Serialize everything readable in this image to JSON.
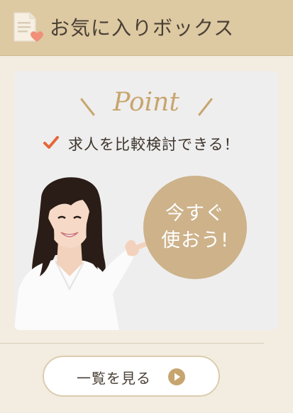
{
  "header": {
    "title": "お気に入りボックス",
    "icon": "document-heart-icon"
  },
  "promo": {
    "heading": "Point",
    "feature": "求人を比較検討できる！",
    "cta_line1": "今すぐ",
    "cta_line2": "使おう!",
    "image": "smiling-woman-pointing-photo"
  },
  "list_button": {
    "label": "一覧を見る",
    "icon": "play-circle-icon"
  },
  "colors": {
    "header_bg": "#ddc9a2",
    "accent_gold": "#c7a56e",
    "circle": "#cdb28a",
    "check": "#e4673b",
    "heart": "#f09078",
    "background": "#f3ece0"
  }
}
